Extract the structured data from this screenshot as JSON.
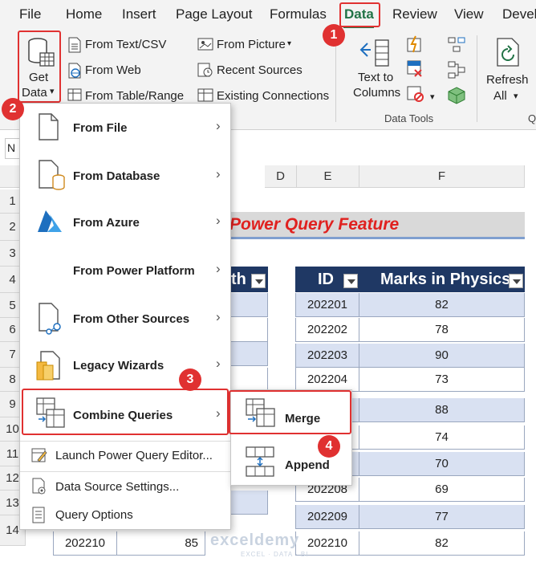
{
  "ribbon_tabs": [
    "File",
    "Home",
    "Insert",
    "Page Layout",
    "Formulas",
    "Data",
    "Review",
    "View",
    "Devel"
  ],
  "active_tab": "Data",
  "accent_color": "#217346",
  "highlight_color": "#e03131",
  "ribbon": {
    "get_data_line1": "Get",
    "get_data_line2": "Data",
    "from_text_csv": "From Text/CSV",
    "from_web": "From Web",
    "from_table_range": "From Table/Range",
    "from_picture": "From Picture",
    "recent_sources": "Recent Sources",
    "existing_connections": "Existing Connections",
    "text_to_columns_line1": "Text to",
    "text_to_columns_line2": "Columns",
    "data_tools_label": "Data Tools",
    "refresh_line1": "Refresh",
    "refresh_line2": "All"
  },
  "badges": [
    "1",
    "2",
    "3",
    "4"
  ],
  "namebox_value": "N",
  "columns": [
    "D",
    "E",
    "F"
  ],
  "rows": [
    "1",
    "2",
    "3",
    "4",
    "5",
    "6",
    "7",
    "8",
    "9",
    "10",
    "11",
    "12",
    "13",
    "14"
  ],
  "sheet_title": "Power Query Feature",
  "left_table_header_fragment": "th",
  "right_table": {
    "headers": [
      "ID",
      "Marks in Physics"
    ],
    "rows": [
      [
        "202201",
        "82"
      ],
      [
        "202202",
        "78"
      ],
      [
        "202203",
        "90"
      ],
      [
        "202204",
        "73"
      ],
      [
        "",
        "88"
      ],
      [
        "",
        "74"
      ],
      [
        "",
        "70"
      ],
      [
        "202208",
        "69"
      ],
      [
        "202209",
        "77"
      ],
      [
        "202210",
        "82"
      ]
    ]
  },
  "left_table_last_row": [
    "202210",
    "85"
  ],
  "get_data_menu": {
    "items": [
      {
        "label": "From File",
        "icon": "file-icon"
      },
      {
        "label": "From Database",
        "icon": "database-icon"
      },
      {
        "label": "From Azure",
        "icon": "azure-icon"
      },
      {
        "label": "From Power Platform",
        "icon": ""
      },
      {
        "label": "From Other Sources",
        "icon": "other-sources-icon"
      },
      {
        "label": "Legacy Wizards",
        "icon": "legacy-wizards-icon"
      },
      {
        "label": "Combine Queries",
        "icon": "combine-queries-icon"
      }
    ],
    "bottom_items": [
      {
        "label": "Launch Power Query Editor...",
        "icon": "power-query-editor-icon"
      },
      {
        "label": "Data Source Settings...",
        "icon": "data-source-settings-icon"
      },
      {
        "label": "Query Options",
        "icon": "query-options-icon"
      }
    ]
  },
  "combine_submenu": {
    "merge": "Merge",
    "append": "Append"
  },
  "watermark": "exceldemy",
  "watermark_sub": "EXCEL · DATA · BI"
}
